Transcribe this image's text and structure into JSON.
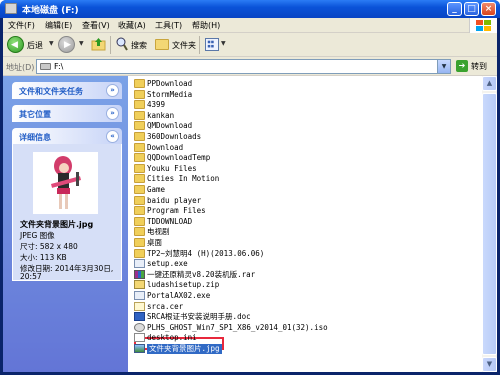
{
  "window": {
    "title": "本地磁盘 (F:)"
  },
  "menu": [
    "文件(F)",
    "编辑(E)",
    "查看(V)",
    "收藏(A)",
    "工具(T)",
    "帮助(H)"
  ],
  "toolbar": {
    "back_label": "后退",
    "search_label": "搜索",
    "folders_label": "文件夹"
  },
  "address": {
    "label": "地址(D)",
    "value": "F:\\",
    "go_label": "转到"
  },
  "tasks": {
    "file_tasks_title": "文件和文件夹任务",
    "other_places_title": "其它位置",
    "details_title": "详细信息"
  },
  "details": {
    "filename": "文件夹背景图片.jpg",
    "type": "JPEG 图像",
    "dimensions": "尺寸: 582 x 480",
    "size": "大小: 113 KB",
    "modified_line1": "修改日期: 2014年3月30日,",
    "modified_line2": "20:57"
  },
  "files": [
    {
      "name": "PPDownload",
      "type": "folder"
    },
    {
      "name": "StormMedia",
      "type": "folder"
    },
    {
      "name": "4399",
      "type": "folder"
    },
    {
      "name": "kankan",
      "type": "folder"
    },
    {
      "name": "QMDownload",
      "type": "folder"
    },
    {
      "name": "360Downloads",
      "type": "folder"
    },
    {
      "name": "Download",
      "type": "folder"
    },
    {
      "name": "QQDownloadTemp",
      "type": "folder"
    },
    {
      "name": "Youku Files",
      "type": "folder"
    },
    {
      "name": "Cities In Motion",
      "type": "folder"
    },
    {
      "name": "Game",
      "type": "folder"
    },
    {
      "name": "baidu player",
      "type": "folder"
    },
    {
      "name": "Program Files",
      "type": "folder"
    },
    {
      "name": "TDDOWNLOAD",
      "type": "folder"
    },
    {
      "name": "电视剧",
      "type": "folder"
    },
    {
      "name": "桌面",
      "type": "folder"
    },
    {
      "name": "TP2~刘慧明4 (H)(2013.06.06)",
      "type": "folder"
    },
    {
      "name": "setup.exe",
      "type": "exe"
    },
    {
      "name": "一键还原精灵v8.20装机版.rar",
      "type": "rar"
    },
    {
      "name": "ludashisetup.zip",
      "type": "zip"
    },
    {
      "name": "PortalAX02.exe",
      "type": "exe"
    },
    {
      "name": "srca.cer",
      "type": "cer"
    },
    {
      "name": "SRCA根证书安装说明手册.doc",
      "type": "doc"
    },
    {
      "name": "PLHS_GHOST_Win7_SP1_X86_v2014_01(32).iso",
      "type": "iso"
    },
    {
      "name": "desktop.ini",
      "type": "ini"
    },
    {
      "name": "文件夹背景图片.jpg",
      "type": "jpg",
      "selected": true
    }
  ],
  "colors": {
    "titlebar": "#0a53d8",
    "taskpane": "#6f8fe0",
    "selection": "#316ac5",
    "highlight_box": "#e8283c"
  }
}
